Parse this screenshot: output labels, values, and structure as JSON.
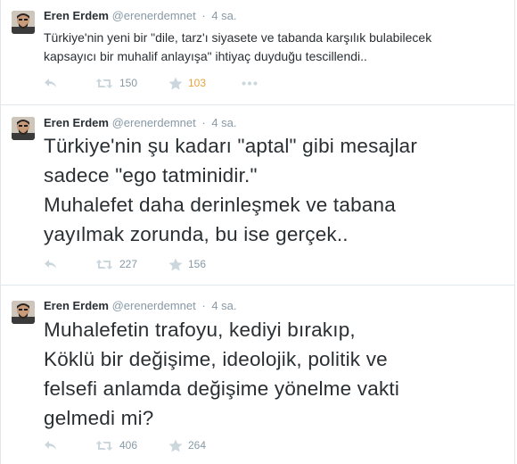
{
  "tweets": [
    {
      "name": "Eren Erdem",
      "handle": "@erenerdemnet",
      "time": "4 sa.",
      "text": "Türkiye'nin yeni bir \"dile, tarz'ı siyasete ve tabanda karşılık bulabilecek\nkapsayıcı bir muhalif anlayışa\" ihtiyaç duyduğu tescillendi..",
      "retweets": "150",
      "favorites": "103",
      "favorited": true
    },
    {
      "name": "Eren Erdem",
      "handle": "@erenerdemnet",
      "time": "4 sa.",
      "text": "Türkiye'nin şu kadarı \"aptal\" gibi mesajlar\nsadece \"ego tatminidir.\"\nMuhalefet daha derinleşmek ve tabana\nyayılmak zorunda, bu ise gerçek..",
      "retweets": "227",
      "favorites": "156",
      "favorited": false
    },
    {
      "name": "Eren Erdem",
      "handle": "@erenerdemnet",
      "time": "4 sa.",
      "text": "Muhalefetin trafoyu, kediyi bırakıp,\nKöklü bir değişime, ideolojik, politik ve\nfelsefi anlamda değişime yönelme vakti\ngelmedi mi?",
      "retweets": "406",
      "favorites": "264",
      "favorited": false
    }
  ],
  "icons": {
    "reply": "reply-icon",
    "retweet": "retweet-icon",
    "favorite": "star-icon",
    "more": "more-icon"
  },
  "colors": {
    "text": "#292f33",
    "muted": "#8899a6",
    "favorite_active": "#e8a33c",
    "border": "#e1e8ed"
  }
}
